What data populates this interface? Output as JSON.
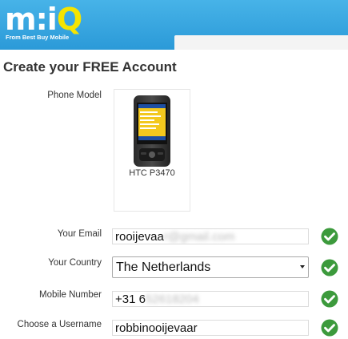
{
  "header": {
    "logo_main": "m:i",
    "logo_accent": "Q",
    "logo_tagline": "From Best Buy Mobile"
  },
  "page_title": "Create your FREE Account",
  "form": {
    "phone_model": {
      "label": "Phone Model",
      "name": "HTC P3470"
    },
    "email": {
      "label": "Your Email",
      "value_visible": "rooijevaa",
      "value_obscured": "r@gmail.com",
      "status_icon": "check-circle-icon"
    },
    "country": {
      "label": "Your Country",
      "selected": "The Netherlands",
      "status_icon": "check-circle-icon"
    },
    "mobile": {
      "label": "Mobile Number",
      "value_visible": "+31 6",
      "value_obscured": "52618204",
      "status_icon": "check-circle-icon"
    },
    "username": {
      "label": "Choose a Username",
      "value": "robbinooijevaar",
      "status_icon": "check-circle-icon"
    }
  },
  "colors": {
    "header_blue": "#2b9ad8",
    "logo_yellow": "#f5e400",
    "check_green": "#3c9a3c"
  }
}
